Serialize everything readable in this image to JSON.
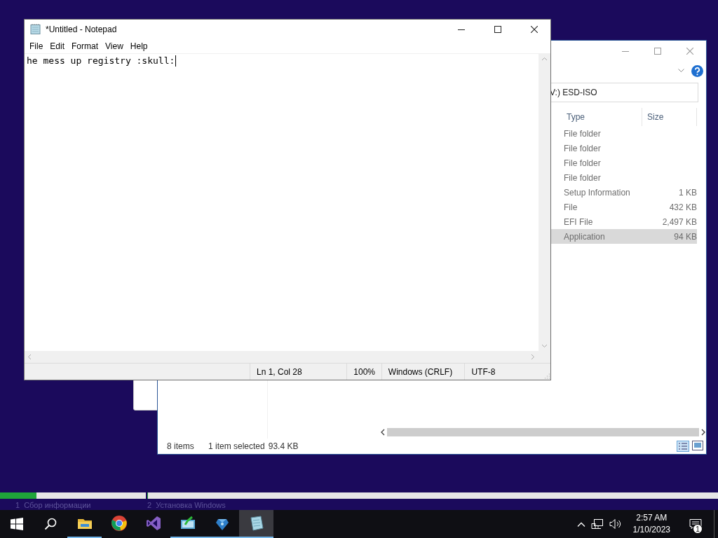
{
  "setup": {
    "steps": [
      {
        "number": "1",
        "label": "Сбор информации",
        "level": 0.25
      },
      {
        "number": "2",
        "label": "Установка Windows",
        "level": 0
      }
    ]
  },
  "explorer": {
    "address": "V:) ESD-ISO",
    "columns": [
      "Type",
      "Size"
    ],
    "rows": [
      {
        "type": "File folder",
        "selected": false
      },
      {
        "type": "File folder",
        "selected": false
      },
      {
        "type": "File folder",
        "selected": false
      },
      {
        "type": "File folder",
        "selected": false
      },
      {
        "type": "Setup Information",
        "size": "1 KB",
        "selected": false
      },
      {
        "type": "File",
        "size": "432 KB",
        "selected": false
      },
      {
        "type": "EFI File",
        "size": "2,497 KB",
        "selected": false
      },
      {
        "type": "Application",
        "size": "94 KB",
        "selected": true
      }
    ],
    "status": {
      "count": "8 items",
      "selection": "1 item selected",
      "size": "93.4 KB"
    }
  },
  "notepad": {
    "title": "*Untitled - Notepad",
    "menu": [
      "File",
      "Edit",
      "Format",
      "View",
      "Help"
    ],
    "text": "he mess up registry :skull:",
    "status": [
      "Ln 1, Col 28",
      "100%",
      "Windows (CRLF)",
      "UTF-8"
    ]
  },
  "taskbar": {
    "apps": [
      {
        "kind": "folder",
        "active": false,
        "running": true
      },
      {
        "kind": "browser",
        "active": false,
        "running": false
      },
      {
        "kind": "studio",
        "active": false,
        "running": false
      },
      {
        "kind": "installer",
        "active": false,
        "running": true
      },
      {
        "kind": "package",
        "active": false,
        "running": true
      },
      {
        "kind": "notepad",
        "active": true,
        "running": true
      }
    ],
    "time": "2:57 AM",
    "date": "1/10/2023",
    "notifications": "1"
  }
}
